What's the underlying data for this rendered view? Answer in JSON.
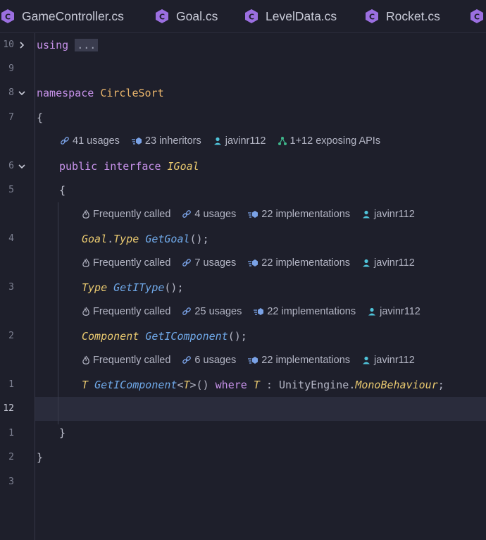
{
  "tabs": [
    {
      "label": "GameController.cs"
    },
    {
      "label": "Goal.cs"
    },
    {
      "label": "LevelData.cs"
    },
    {
      "label": "Rocket.cs"
    }
  ],
  "gutter": {
    "line_numbers": [
      "10",
      "9",
      "8",
      "7",
      "6",
      "5",
      "4",
      "3",
      "2",
      "1",
      "12",
      "1",
      "2",
      "3"
    ]
  },
  "code": {
    "using_kw": "using",
    "using_fold": "...",
    "namespace_kw": "namespace",
    "namespace_name": "CircleSort",
    "open_brace_ns": "{",
    "public_kw": "public",
    "interface_kw": "interface",
    "interface_name": "IGoal",
    "open_brace_if": "{",
    "m1_type_a": "Goal",
    "m1_dot": ".",
    "m1_type_b": "Type",
    "m1_name": "GetGoal",
    "m1_tail": "();",
    "m2_type": "Type",
    "m2_name": "GetIType",
    "m2_tail": "();",
    "m3_type": "Component",
    "m3_name": "GetIComponent",
    "m3_tail": "();",
    "m4_T": "T",
    "m4_name": "GetIComponent",
    "m4_lt": "<",
    "m4_Tp": "T",
    "m4_gt": ">()",
    "m4_where": "where",
    "m4_T2": "T",
    "m4_colon": ":",
    "m4_ns": "UnityEngine",
    "m4_dot": ".",
    "m4_base": "MonoBehaviour",
    "m4_semi": ";",
    "close_brace_if": "}",
    "close_brace_ns": "}"
  },
  "hints": {
    "interface": {
      "usages": "41 usages",
      "inheritors": "23 inheritors",
      "author": "javinr112",
      "apis": "1+12 exposing APIs"
    },
    "m1": {
      "freq": "Frequently called",
      "usages": "4 usages",
      "impl": "22 implementations",
      "author": "javinr112"
    },
    "m2": {
      "freq": "Frequently called",
      "usages": "7 usages",
      "impl": "22 implementations",
      "author": "javinr112"
    },
    "m3": {
      "freq": "Frequently called",
      "usages": "25 usages",
      "impl": "22 implementations",
      "author": "javinr112"
    },
    "m4": {
      "freq": "Frequently called",
      "usages": "6 usages",
      "impl": "22 implementations",
      "author": "javinr112"
    }
  },
  "colors": {
    "background": "#1e1f2b",
    "current_line": "#2a2c3c",
    "keyword": "#c792ea",
    "type": "#e8c86f",
    "method": "#6fa8e8",
    "cs_icon": "#9b6fe0",
    "author_icon": "#4fc3d9"
  }
}
